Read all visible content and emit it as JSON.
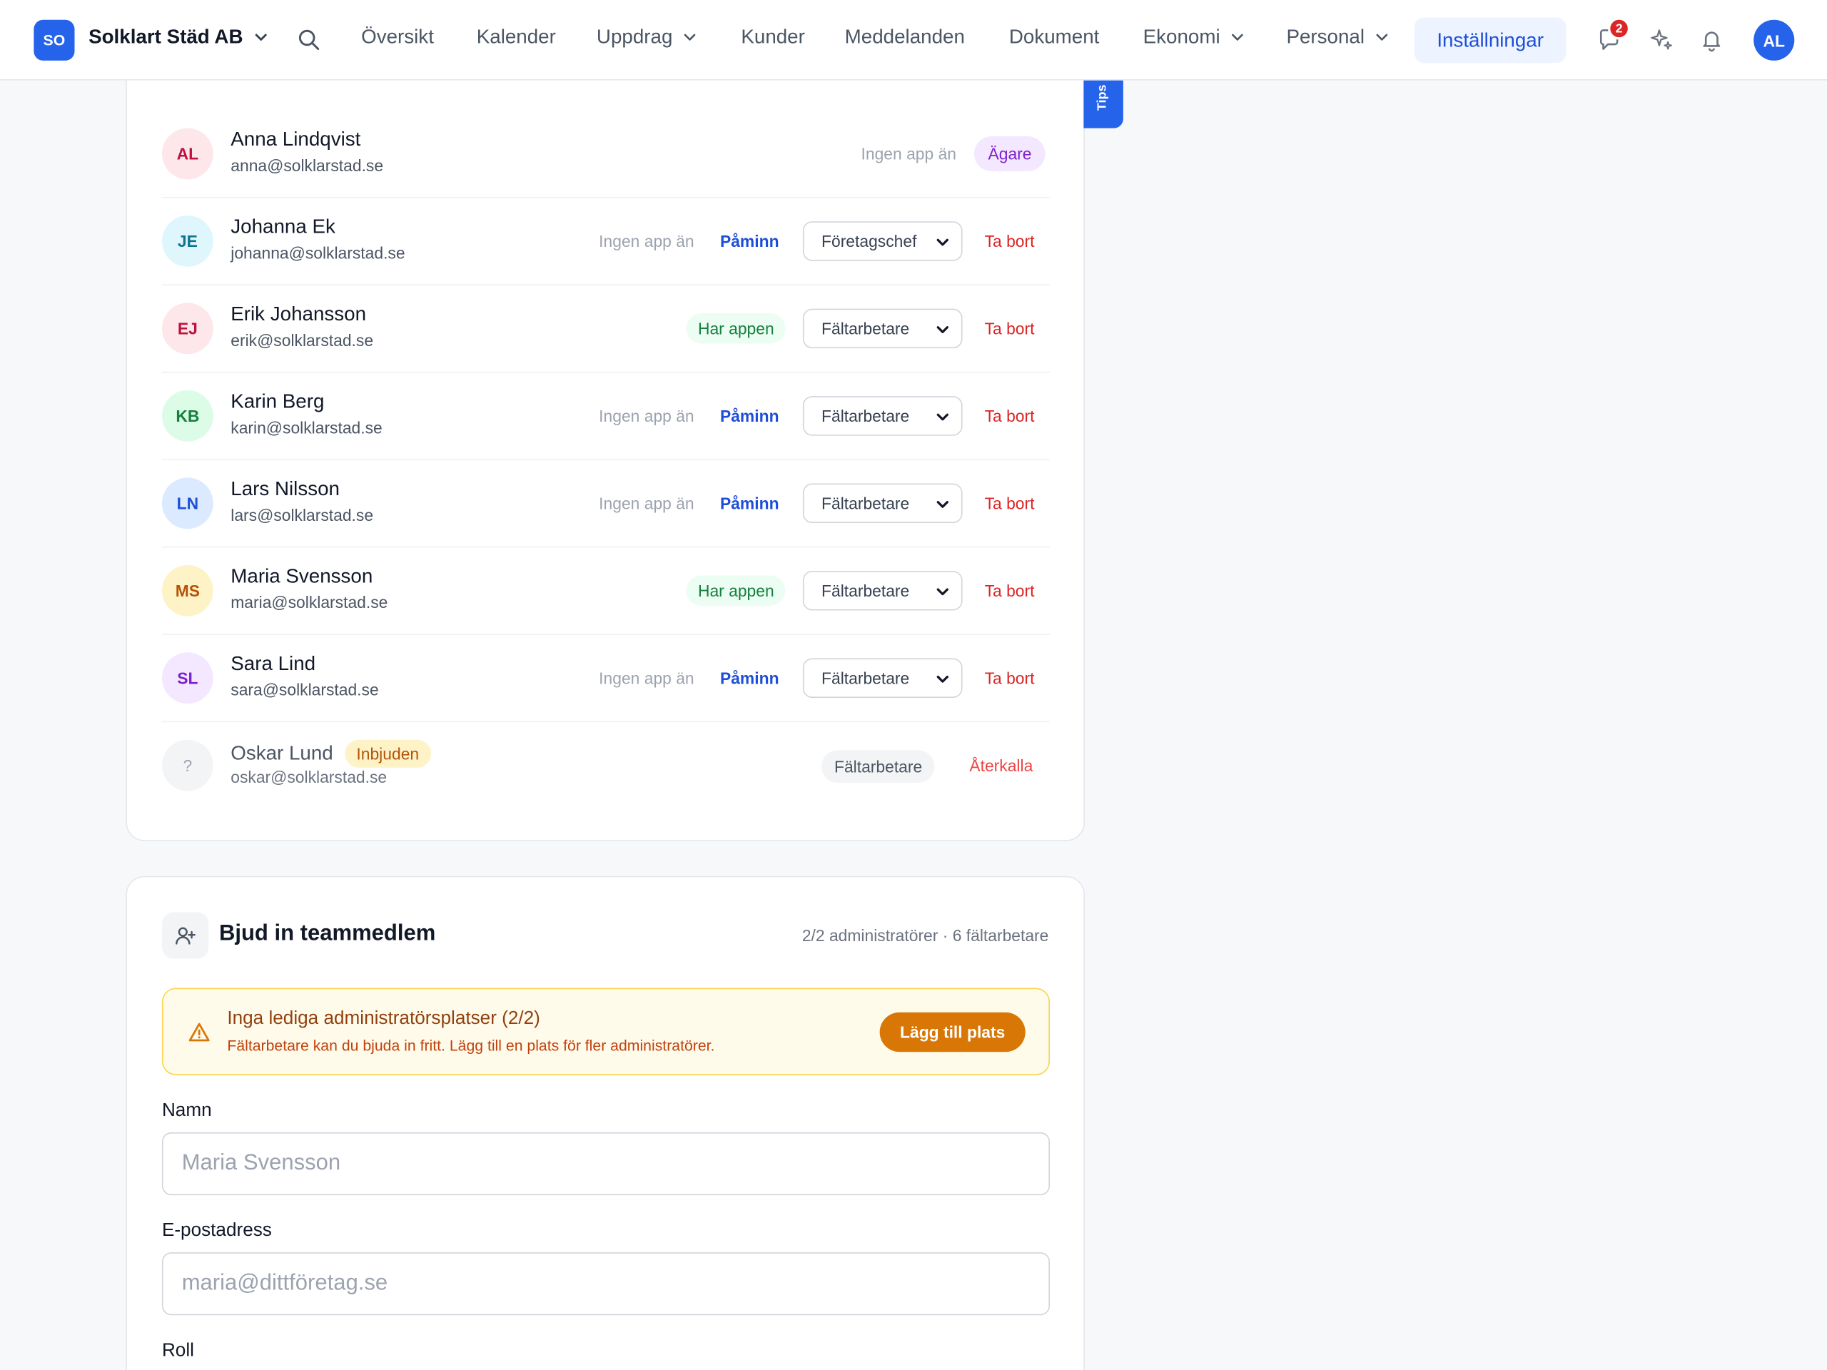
{
  "company": {
    "badge": "SO",
    "name": "Solklart Städ AB"
  },
  "nav": {
    "items": [
      "Översikt",
      "Kalender",
      "Uppdrag",
      "Kunder",
      "Meddelanden",
      "Dokument",
      "Ekonomi",
      "Personal"
    ],
    "active": "Inställningar",
    "message_count": "2",
    "user_initials": "AL"
  },
  "tips": {
    "label": "Tips"
  },
  "members": [
    {
      "initials": "AL",
      "name": "Anna Lindqvist",
      "email": "anna@solklarstad.se",
      "app_status": "Ingen app än",
      "role": "Ägare"
    },
    {
      "initials": "JE",
      "name": "Johanna Ek",
      "email": "johanna@solklarstad.se",
      "app_status": "Ingen app än",
      "remind": "Påminn",
      "role": "Företagschef",
      "remove": "Ta bort"
    },
    {
      "initials": "EJ",
      "name": "Erik Johansson",
      "email": "erik@solklarstad.se",
      "app_status": "Har appen",
      "role": "Fältarbetare",
      "remove": "Ta bort"
    },
    {
      "initials": "KB",
      "name": "Karin Berg",
      "email": "karin@solklarstad.se",
      "app_status": "Ingen app än",
      "remind": "Påminn",
      "role": "Fältarbetare",
      "remove": "Ta bort"
    },
    {
      "initials": "LN",
      "name": "Lars Nilsson",
      "email": "lars@solklarstad.se",
      "app_status": "Ingen app än",
      "remind": "Påminn",
      "role": "Fältarbetare",
      "remove": "Ta bort"
    },
    {
      "initials": "MS",
      "name": "Maria Svensson",
      "email": "maria@solklarstad.se",
      "app_status": "Har appen",
      "role": "Fältarbetare",
      "remove": "Ta bort"
    },
    {
      "initials": "SL",
      "name": "Sara Lind",
      "email": "sara@solklarstad.se",
      "app_status": "Ingen app än",
      "remind": "Påminn",
      "role": "Fältarbetare",
      "remove": "Ta bort"
    },
    {
      "initials": "?",
      "name": "Oskar Lund",
      "invited": "Inbjuden",
      "email": "oskar@solklarstad.se",
      "role": "Fältarbetare",
      "revoke": "Återkalla"
    }
  ],
  "invite": {
    "title": "Bjud in teammedlem",
    "meta": "2/2 administratörer · 6 fältarbetare",
    "warning_title": "Inga lediga administratörsplatser (2/2)",
    "warning_text": "Fältarbetare kan du bjuda in fritt. Lägg till en plats för fler administratörer.",
    "warning_button": "Lägg till plats",
    "name_label": "Namn",
    "name_placeholder": "Maria Svensson",
    "email_label": "E-postadress",
    "email_placeholder": "maria@dittföretag.se",
    "role_label": "Roll"
  },
  "colors": {
    "accent": "#2563eb",
    "danger": "#dc2626",
    "warning": "#d97706"
  }
}
